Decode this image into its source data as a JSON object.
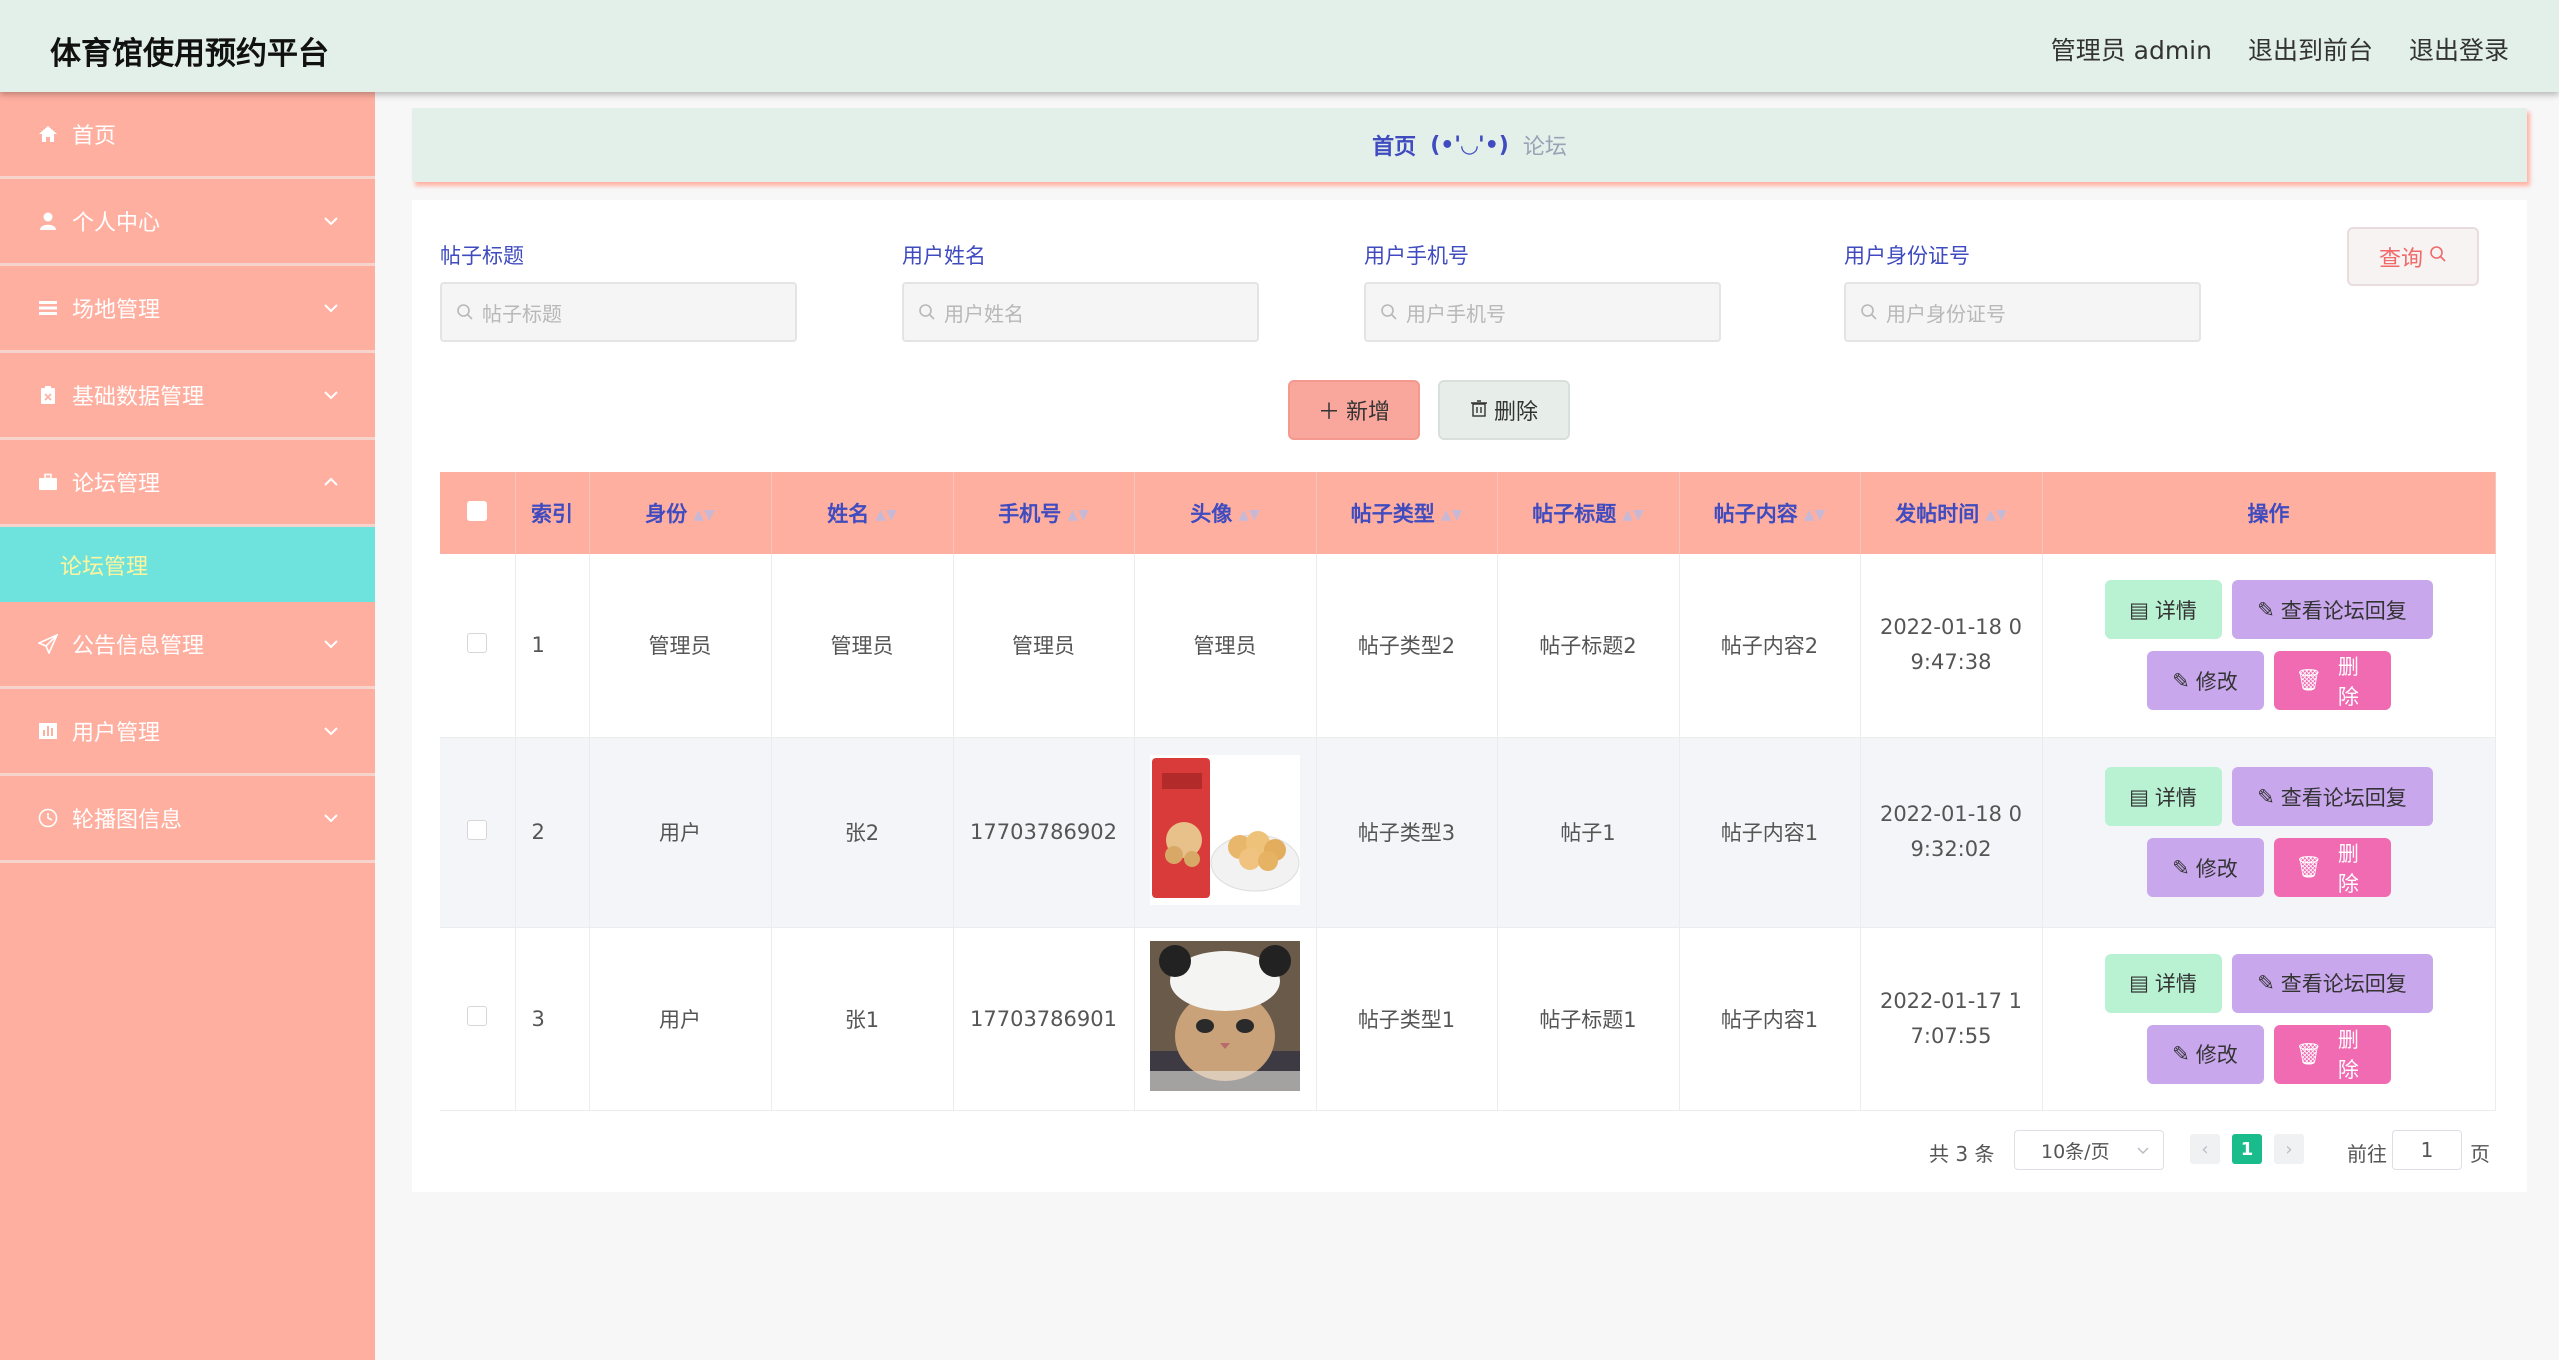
{
  "header": {
    "title": "体育馆使用预约平台",
    "user": "管理员 admin",
    "to_front": "退出到前台",
    "logout": "退出登录"
  },
  "sidebar": {
    "items": [
      {
        "label": "首页",
        "icon": "home-icon"
      },
      {
        "label": "个人中心",
        "icon": "user-icon"
      },
      {
        "label": "场地管理",
        "icon": "menu-icon"
      },
      {
        "label": "基础数据管理",
        "icon": "clipboard-icon"
      },
      {
        "label": "论坛管理",
        "icon": "briefcase-icon"
      },
      {
        "label": "公告信息管理",
        "icon": "send-icon"
      },
      {
        "label": "用户管理",
        "icon": "chart-icon"
      },
      {
        "label": "轮播图信息",
        "icon": "clock-icon"
      }
    ],
    "sub_active": "论坛管理"
  },
  "breadcrumb": {
    "home": "首页",
    "face": "(•'◡'•)",
    "current": "论坛"
  },
  "filters": {
    "title_label": "帖子标题",
    "title_placeholder": "帖子标题",
    "name_label": "用户姓名",
    "name_placeholder": "用户姓名",
    "phone_label": "用户手机号",
    "phone_placeholder": "用户手机号",
    "id_label": "用户身份证号",
    "id_placeholder": "用户身份证号",
    "query_label": "查询"
  },
  "actions": {
    "add_label": "新增",
    "delete_label": "删除"
  },
  "table": {
    "columns": [
      "索引",
      "身份",
      "姓名",
      "手机号",
      "头像",
      "帖子类型",
      "帖子标题",
      "帖子内容",
      "发帖时间",
      "操作"
    ],
    "rows": [
      {
        "index": "1",
        "role": "管理员",
        "name": "管理员",
        "phone": "管理员",
        "avatar": "管理员",
        "type": "帖子类型2",
        "title": "帖子标题2",
        "content": "帖子内容2",
        "time_line1": "2022-01-18 0",
        "time_line2": "9:47:38"
      },
      {
        "index": "2",
        "role": "用户",
        "name": "张2",
        "phone": "17703786902",
        "avatar": "",
        "type": "帖子类型3",
        "title": "帖子1",
        "content": "帖子内容1",
        "time_line1": "2022-01-18 0",
        "time_line2": "9:32:02"
      },
      {
        "index": "3",
        "role": "用户",
        "name": "张1",
        "phone": "17703786901",
        "avatar": "",
        "type": "帖子类型1",
        "title": "帖子标题1",
        "content": "帖子内容1",
        "time_line1": "2022-01-17 1",
        "time_line2": "7:07:55"
      }
    ],
    "op_detail": "详情",
    "op_reply": "查看论坛回复",
    "op_edit": "修改",
    "op_delete": "删除"
  },
  "pagination": {
    "total": "共 3 条",
    "page_size": "10条/页",
    "current_page": "1",
    "goto_label": "前往",
    "goto_value": "1",
    "page_unit": "页"
  },
  "colors": {
    "header_bg": "#e3f0ea",
    "sidebar_bg": "#ffafa0",
    "sidebar_active": "#6ee2dc",
    "accent_text": "#3f4bbf",
    "detail_btn": "#b9f1d3",
    "reply_btn": "#c8a7ec",
    "delete_btn": "#f06bb1",
    "page_active": "#1bbc8c"
  }
}
